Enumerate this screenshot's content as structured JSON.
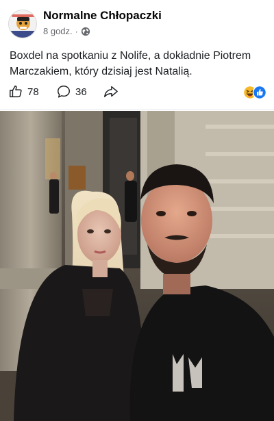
{
  "post": {
    "page_name": "Normalne Chłopaczki",
    "timestamp": "8 godz.",
    "separator": "·",
    "audience_icon": "globe-icon",
    "text": "Boxdel na spotkaniu z Nolife, a dokładnie Piotrem Marczakiem, który dzisiaj jest Natalią."
  },
  "actions": {
    "like_count": "78",
    "comment_count": "36",
    "like_icon": "thumbs-up-icon",
    "comment_icon": "comment-bubble-icon",
    "share_icon": "share-arrow-icon",
    "reaction_icons": [
      "laughing-emoji-icon",
      "like-reaction-icon"
    ]
  },
  "colors": {
    "text_primary": "#050505",
    "text_secondary": "#65676b",
    "like_blue": "#1877f2",
    "haha_yellow": "#f7b928",
    "divider": "#e4e6eb"
  }
}
